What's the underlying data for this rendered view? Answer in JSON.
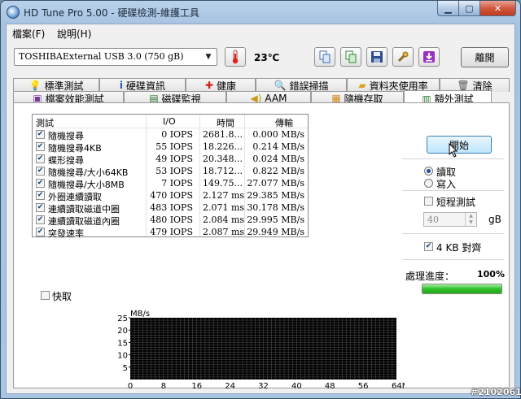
{
  "window": {
    "title": "HD Tune Pro  5.00 - 硬碟檢測-維護工具"
  },
  "menu": [
    {
      "label": "檔案(F)"
    },
    {
      "label": "說明(H)"
    }
  ],
  "toolbar": {
    "drive": "TOSHIBAExternal USB 3.0 (750 gB)",
    "temperature": "23℃",
    "exit_label": "離開"
  },
  "tabs_top": [
    {
      "label": "標準測試",
      "icon": "bulb-icon"
    },
    {
      "label": "硬碟資訊",
      "icon": "info-icon"
    },
    {
      "label": "健康",
      "icon": "health-cross-icon"
    },
    {
      "label": "錯誤掃描",
      "icon": "magnifier-icon"
    },
    {
      "label": "資料夾使用率",
      "icon": "folder-icon"
    },
    {
      "label": "清除",
      "icon": "trash-icon"
    }
  ],
  "tabs_bottom": [
    {
      "label": "檔案效能測試",
      "icon": "file-benchmark-icon"
    },
    {
      "label": "磁碟監視",
      "icon": "monitor-icon"
    },
    {
      "label": "AAM",
      "icon": "speaker-icon"
    },
    {
      "label": "隨機存取",
      "icon": "random-access-icon"
    },
    {
      "label": "額外測試",
      "icon": "extra-tests-icon",
      "active": true
    }
  ],
  "results": {
    "headers": {
      "test": "測試",
      "io": "I/O",
      "time": "時間",
      "transfer": "傳輸"
    },
    "rows": [
      {
        "checked": true,
        "name": "隨機搜尋",
        "io": "0 IOPS",
        "time": "2681.8...",
        "transfer": "0.000 MB/s"
      },
      {
        "checked": true,
        "name": "隨機搜尋4KB",
        "io": "55 IOPS",
        "time": "18.226...",
        "transfer": "0.214 MB/s"
      },
      {
        "checked": true,
        "name": "蝶形搜尋",
        "io": "49 IOPS",
        "time": "20.348...",
        "transfer": "0.024 MB/s"
      },
      {
        "checked": true,
        "name": "隨機搜尋/大小64KB",
        "io": "53 IOPS",
        "time": "18.712...",
        "transfer": "0.822 MB/s"
      },
      {
        "checked": true,
        "name": "隨機搜尋/大小8MB",
        "io": "7 IOPS",
        "time": "149.75...",
        "transfer": "27.077 MB/s"
      },
      {
        "checked": true,
        "name": "外圈連續讀取",
        "io": "470 IOPS",
        "time": "2.127 ms",
        "transfer": "29.385 MB/s"
      },
      {
        "checked": true,
        "name": "連續讀取磁道中圈",
        "io": "483 IOPS",
        "time": "2.071 ms",
        "transfer": "30.178 MB/s"
      },
      {
        "checked": true,
        "name": "連續讀取磁道內圈",
        "io": "480 IOPS",
        "time": "2.084 ms",
        "transfer": "29.995 MB/s"
      },
      {
        "checked": true,
        "name": "突發速率",
        "io": "479 IOPS",
        "time": "2.087 ms",
        "transfer": "29.949 MB/s"
      }
    ]
  },
  "fast": {
    "label": "快取",
    "checked": false
  },
  "controls": {
    "start_label": "開始",
    "read_label": "讀取",
    "write_label": "寫入",
    "mode": "read",
    "short_test_label": "短程測試",
    "short_test_checked": false,
    "size_value": "40",
    "size_unit": "gB",
    "align_label": "4 KB 對齊",
    "align_checked": true,
    "progress_label": "處理進度：",
    "progress_value": "100%",
    "progress_fraction": 1.0
  },
  "chart_data": {
    "type": "line",
    "ylabel": "MB/s",
    "xlabel_unit": "MB",
    "x_ticks": [
      "0",
      "8",
      "16",
      "24",
      "32",
      "40",
      "48",
      "56",
      "64MB"
    ],
    "y_ticks": [
      "25",
      "20",
      "15",
      "10",
      "5"
    ],
    "ylim": [
      0,
      25
    ],
    "xlim": [
      0,
      64
    ],
    "grid": true,
    "series": []
  },
  "watermark": "#2102061",
  "colors": {
    "chart_bg": "#000000",
    "grid": "#555555",
    "progress": "#2fc12a"
  }
}
